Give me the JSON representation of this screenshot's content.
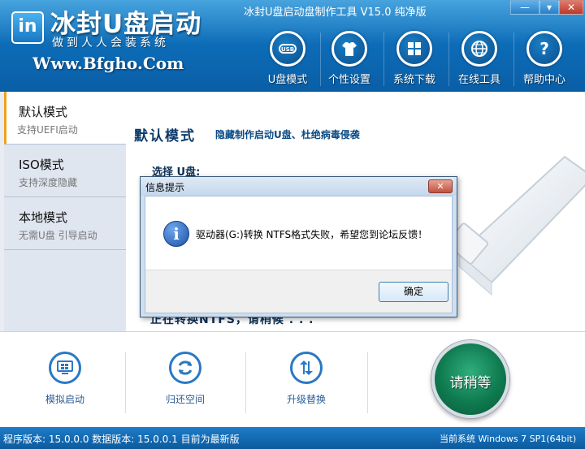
{
  "header": {
    "logo_mark": "in",
    "logo_title": "冰封U盘启动",
    "slogan": "做到人人会装系统",
    "website": "Www.Bfgho.Com",
    "app_title": "冰封U盘启动盘制作工具 V15.0 纯净版",
    "window_controls": {
      "minimize": "—",
      "maximize": "▾",
      "close": "✕"
    },
    "nav": [
      {
        "label": "U盘模式",
        "icon": "usb-icon"
      },
      {
        "label": "个性设置",
        "icon": "tshirt-icon"
      },
      {
        "label": "系统下载",
        "icon": "windows-icon"
      },
      {
        "label": "在线工具",
        "icon": "globe-icon"
      },
      {
        "label": "帮助中心",
        "icon": "help-icon"
      }
    ]
  },
  "sidebar": {
    "items": [
      {
        "title": "默认模式",
        "subtitle": "支持UEFI启动",
        "active": true
      },
      {
        "title": "ISO模式",
        "subtitle": "支持深度隐藏",
        "active": false
      },
      {
        "title": "本地模式",
        "subtitle": "无需U盘 引导启动",
        "active": false
      }
    ]
  },
  "main": {
    "mode_title": "默认模式",
    "mode_subtitle": "隐藏制作启动U盘、杜绝病毒侵袭",
    "select_label": "选择 U盘:",
    "status_text": "正在转换NTFS，请稍候 . . ."
  },
  "dialog": {
    "title": "信息提示",
    "close": "✕",
    "info_icon": "i",
    "message": "驱动器(G:)转换 NTFS格式失败，希望您到论坛反馈！",
    "ok_label": "确定"
  },
  "actions": [
    {
      "label": "模拟启动",
      "icon": "monitor-icon"
    },
    {
      "label": "归还空间",
      "icon": "refresh-icon"
    },
    {
      "label": "升级替换",
      "icon": "upgrade-icon"
    }
  ],
  "start_button": {
    "label": "请稍等"
  },
  "status_bar": {
    "left": "程序版本: 15.0.0.0 数据版本: 15.0.0.1 目前为最新版",
    "right": "当前系统 Windows 7 SP1(64bit)"
  }
}
